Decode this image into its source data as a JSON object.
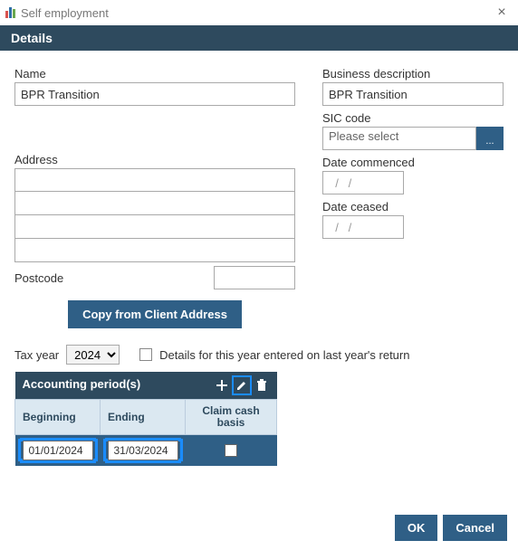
{
  "window": {
    "title": "Self employment"
  },
  "details": {
    "heading": "Details"
  },
  "left": {
    "nameLabel": "Name",
    "nameValue": "BPR Transition",
    "addressLabel": "Address",
    "postcodeLabel": "Postcode",
    "copyButton": "Copy from Client Address"
  },
  "right": {
    "businessDescLabel": "Business description",
    "businessDescValue": "BPR Transition",
    "sicLabel": "SIC code",
    "sicPlaceholder": "Please select",
    "sicButton": "...",
    "dateCommencedLabel": "Date commenced",
    "dateCommencedValue": "  /   /",
    "dateCeasedLabel": "Date ceased",
    "dateCeasedValue": "  /   /"
  },
  "taxYear": {
    "label": "Tax year",
    "value": "2024",
    "checkboxLabel": "Details for this year entered on last year's return"
  },
  "accounting": {
    "heading": "Accounting period(s)",
    "colBeginning": "Beginning",
    "colEnding": "Ending",
    "colClaim": "Claim cash basis",
    "rows": [
      {
        "beginning": "01/01/2024",
        "ending": "31/03/2024",
        "claim": false
      }
    ]
  },
  "footer": {
    "ok": "OK",
    "cancel": "Cancel"
  }
}
